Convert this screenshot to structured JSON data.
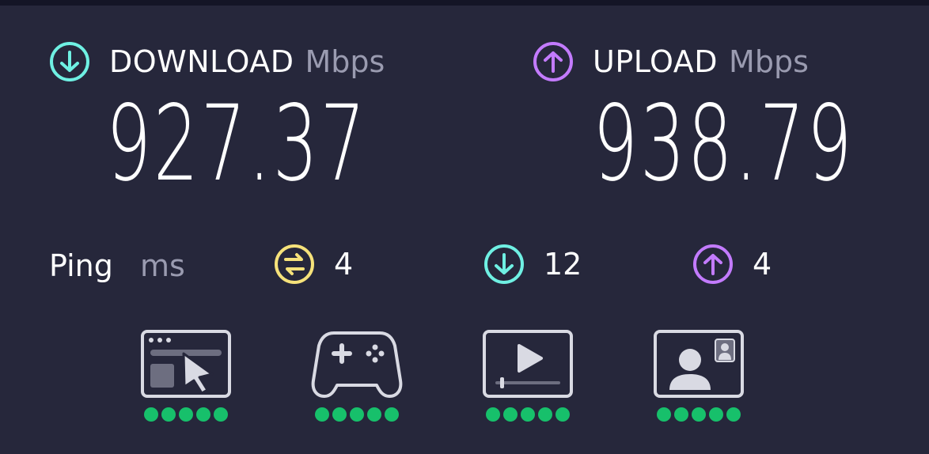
{
  "download": {
    "label": "DOWNLOAD",
    "unit": "Mbps",
    "value": "927.37",
    "color": "#6ff0e3"
  },
  "upload": {
    "label": "UPLOAD",
    "unit": "Mbps",
    "value": "938.79",
    "color": "#c37bff"
  },
  "ping": {
    "label": "Ping",
    "unit": "ms",
    "idle": {
      "value": "4",
      "icon": "idle-latency-icon",
      "color": "#f6e27a"
    },
    "download": {
      "value": "12",
      "icon": "download-latency-icon",
      "color": "#6ff0e3"
    },
    "upload": {
      "value": "4",
      "icon": "upload-latency-icon",
      "color": "#c37bff"
    }
  },
  "use_cases": [
    {
      "name": "browsing",
      "icon": "web-browsing-icon",
      "rating": 5,
      "max_rating": 5
    },
    {
      "name": "gaming",
      "icon": "gamepad-icon",
      "rating": 5,
      "max_rating": 5
    },
    {
      "name": "streaming",
      "icon": "video-streaming-icon",
      "rating": 5,
      "max_rating": 5
    },
    {
      "name": "video-chat",
      "icon": "video-chat-icon",
      "rating": 5,
      "max_rating": 5
    }
  ],
  "colors": {
    "background": "#26273b",
    "rating_dot": "#17c06b",
    "muted_text": "#9a9bb0"
  }
}
